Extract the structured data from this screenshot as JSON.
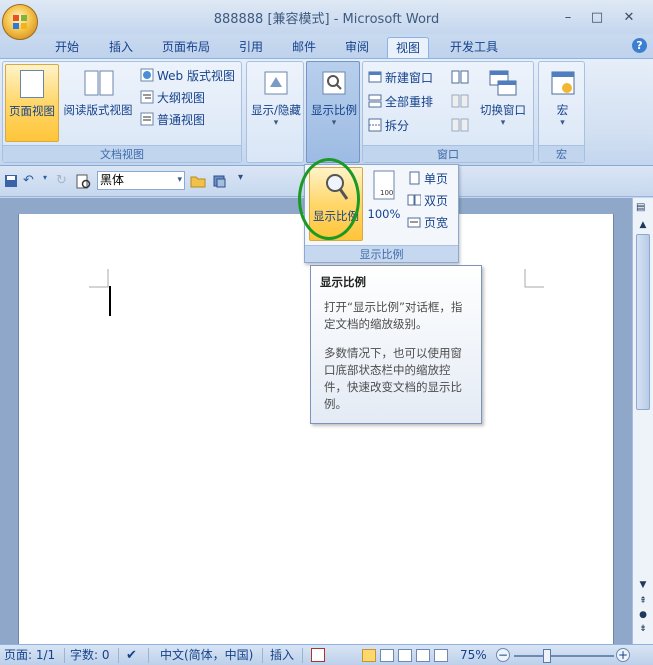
{
  "window": {
    "title": "888888 [兼容模式] - Microsoft Word",
    "controls": [
      "–",
      "□",
      "✕"
    ]
  },
  "tabs": [
    "开始",
    "插入",
    "页面布局",
    "引用",
    "邮件",
    "审阅",
    "视图",
    "开发工具"
  ],
  "active_tab": "视图",
  "ribbon": {
    "doc_views": {
      "label": "文档视图",
      "print_layout": "页面视图",
      "reading_layout": "阅读版式视图",
      "web_layout": "Web 版式视图",
      "outline": "大纲视图",
      "draft": "普通视图"
    },
    "show_hide": "显示/隐藏",
    "zoom": "显示比例",
    "window": {
      "label": "窗口",
      "new_window": "新建窗口",
      "arrange_all": "全部重排",
      "split": "拆分",
      "switch_windows": "切换窗口"
    },
    "macros": {
      "label": "宏",
      "macros_button": "宏"
    }
  },
  "toolbar": {
    "font_name": "黑体"
  },
  "zoom_dropdown": {
    "zoom_button": "显示比例",
    "zoom_100": "100%",
    "one_page": "单页",
    "two_pages": "双页",
    "page_width": "页宽",
    "group_label": "显示比例"
  },
  "tooltip": {
    "title": "显示比例",
    "para1": "打开“显示比例”对话框，指定文档的缩放级别。",
    "para2": "多数情况下，也可以使用窗口底部状态栏中的缩放控件，快速改变文档的显示比例。"
  },
  "statusbar": {
    "page": "页面: 1/1",
    "words": "字数: 0",
    "language": "中文(简体，中国)",
    "mode": "插入",
    "zoom_level": "75%"
  }
}
